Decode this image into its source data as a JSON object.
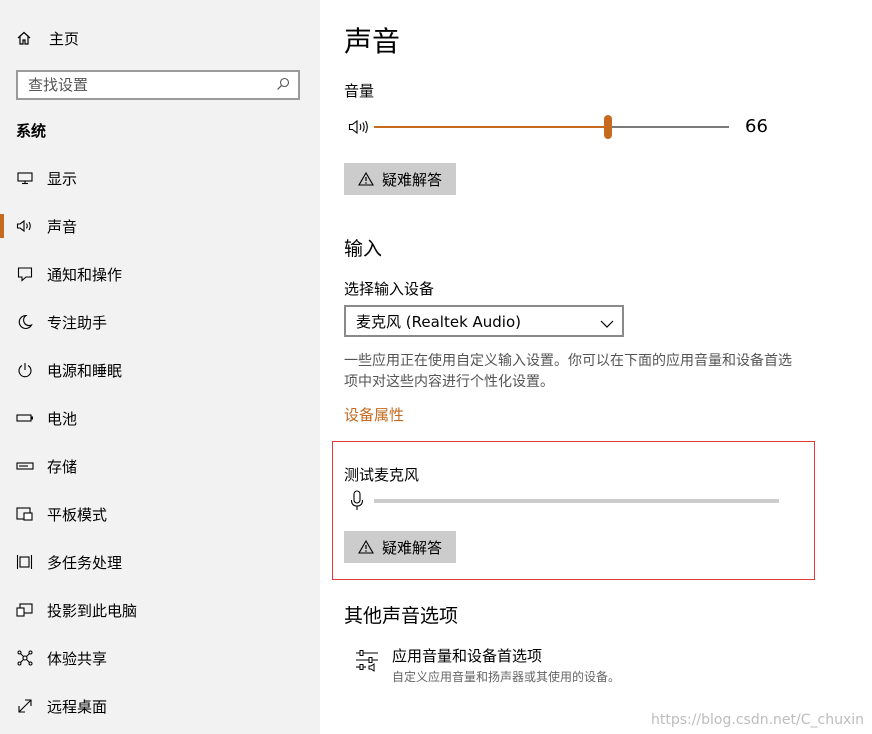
{
  "sidebar": {
    "home_label": "主页",
    "search_placeholder": "查找设置",
    "group_label": "系统",
    "items": [
      {
        "label": "显示",
        "icon": "monitor-icon"
      },
      {
        "label": "声音",
        "icon": "speaker-icon",
        "active": true
      },
      {
        "label": "通知和操作",
        "icon": "notification-icon"
      },
      {
        "label": "专注助手",
        "icon": "moon-icon"
      },
      {
        "label": "电源和睡眠",
        "icon": "power-icon"
      },
      {
        "label": "电池",
        "icon": "battery-icon"
      },
      {
        "label": "存储",
        "icon": "storage-icon"
      },
      {
        "label": "平板模式",
        "icon": "tablet-icon"
      },
      {
        "label": "多任务处理",
        "icon": "multitask-icon"
      },
      {
        "label": "投影到此电脑",
        "icon": "project-icon"
      },
      {
        "label": "体验共享",
        "icon": "share-icon"
      },
      {
        "label": "远程桌面",
        "icon": "remote-icon"
      }
    ]
  },
  "main": {
    "title": "声音",
    "volume": {
      "label": "音量",
      "value": "66",
      "level_percent": 66
    },
    "troubleshoot_label": "疑难解答",
    "input": {
      "section_title": "输入",
      "device_label": "选择输入设备",
      "device_value": "麦克风 (Realtek Audio)",
      "description": "一些应用正在使用自定义输入设置。你可以在下面的应用音量和设备首选项中对这些内容进行个性化设置。",
      "properties_link": "设备属性",
      "test_mic_label": "测试麦克风",
      "mic_level_percent": 0
    },
    "other": {
      "section_title": "其他声音选项",
      "item_title": "应用音量和设备首选项",
      "item_subtitle": "自定义应用音量和扬声器或其使用的设备。"
    }
  },
  "watermark": "https://blog.csdn.net/C_chuxin",
  "colors": {
    "accent": "#c56a1f",
    "highlight_box": "#e53935",
    "sidebar_bg": "#f2f2f2",
    "button_bg": "#cccccc"
  }
}
